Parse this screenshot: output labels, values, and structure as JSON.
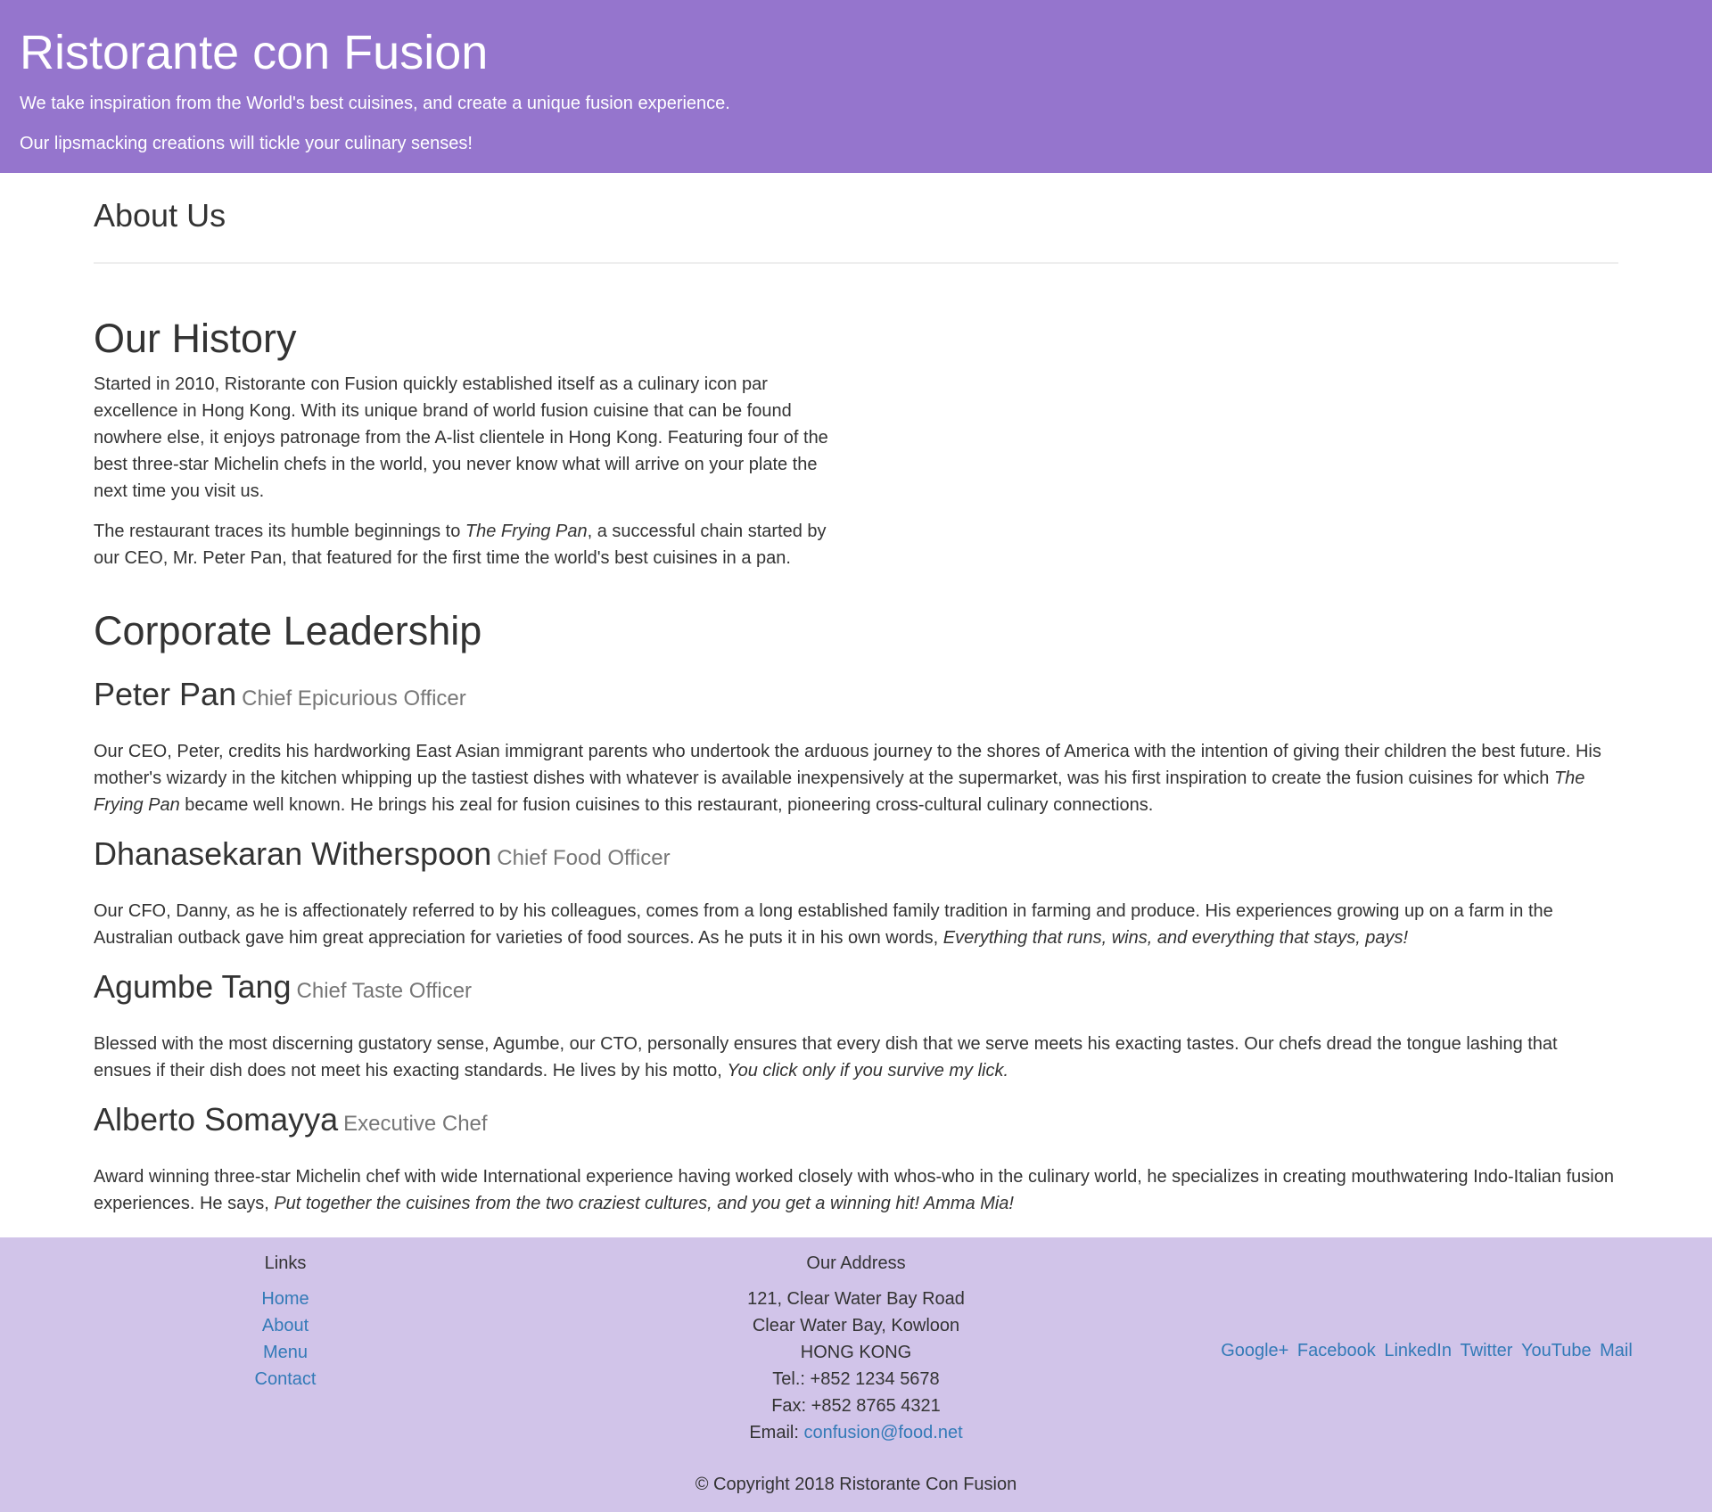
{
  "header": {
    "title": "Ristorante con Fusion",
    "tagline1": "We take inspiration from the World's best cuisines, and create a unique fusion experience.",
    "tagline2": "Our lipsmacking creations will tickle your culinary senses!"
  },
  "page": {
    "heading": "About Us"
  },
  "history": {
    "title": "Our History",
    "para1": "Started in 2010, Ristorante con Fusion quickly established itself as a culinary icon par excellence in Hong Kong. With its unique brand of world fusion cuisine that can be found nowhere else, it enjoys patronage from the A-list clientele in Hong Kong. Featuring four of the best three-star Michelin chefs in the world, you never know what will arrive on your plate the next time you visit us.",
    "para2_before": "The restaurant traces its humble beginnings to ",
    "para2_em": "The Frying Pan",
    "para2_after": ", a successful chain started by our CEO, Mr. Peter Pan, that featured for the first time the world's best cuisines in a pan."
  },
  "leadership": {
    "title": "Corporate Leadership",
    "leaders": [
      {
        "name": "Peter Pan",
        "designation": "Chief Epicurious Officer",
        "desc_before": "Our CEO, Peter, credits his hardworking East Asian immigrant parents who undertook the arduous journey to the shores of America with the intention of giving their children the best future. His mother's wizardy in the kitchen whipping up the tastiest dishes with whatever is available inexpensively at the supermarket, was his first inspiration to create the fusion cuisines for which ",
        "desc_em": "The Frying Pan",
        "desc_after": " became well known. He brings his zeal for fusion cuisines to this restaurant, pioneering cross-cultural culinary connections."
      },
      {
        "name": "Dhanasekaran Witherspoon",
        "designation": "Chief Food Officer",
        "desc_before": "Our CFO, Danny, as he is affectionately referred to by his colleagues, comes from a long established family tradition in farming and produce. His experiences growing up on a farm in the Australian outback gave him great appreciation for varieties of food sources. As he puts it in his own words, ",
        "desc_em": "Everything that runs, wins, and everything that stays, pays!",
        "desc_after": ""
      },
      {
        "name": "Agumbe Tang",
        "designation": "Chief Taste Officer",
        "desc_before": "Blessed with the most discerning gustatory sense, Agumbe, our CTO, personally ensures that every dish that we serve meets his exacting tastes. Our chefs dread the tongue lashing that ensues if their dish does not meet his exacting standards. He lives by his motto, ",
        "desc_em": "You click only if you survive my lick.",
        "desc_after": ""
      },
      {
        "name": "Alberto Somayya",
        "designation": "Executive Chef",
        "desc_before": "Award winning three-star Michelin chef with wide International experience having worked closely with whos-who in the culinary world, he specializes in creating mouthwatering Indo-Italian fusion experiences. He says, ",
        "desc_em": "Put together the cuisines from the two craziest cultures, and you get a winning hit! Amma Mia!",
        "desc_after": ""
      }
    ]
  },
  "footer": {
    "links_title": "Links",
    "links": [
      "Home",
      "About",
      "Menu",
      "Contact"
    ],
    "address_title": "Our Address",
    "address_line1": "121, Clear Water Bay Road",
    "address_line2": "Clear Water Bay, Kowloon",
    "address_line3": "HONG KONG",
    "tel": "Tel.: +852 1234 5678",
    "fax": "Fax: +852 8765 4321",
    "email_label": "Email: ",
    "email": "confusion@food.net",
    "social": [
      "Google+",
      "Facebook",
      "LinkedIn",
      "Twitter",
      "YouTube",
      "Mail"
    ],
    "copyright": "© Copyright 2018 Ristorante Con Fusion"
  },
  "colors": {
    "header_bg": "#9575cd",
    "footer_bg": "#d1c4e9",
    "link": "#337ab7"
  }
}
